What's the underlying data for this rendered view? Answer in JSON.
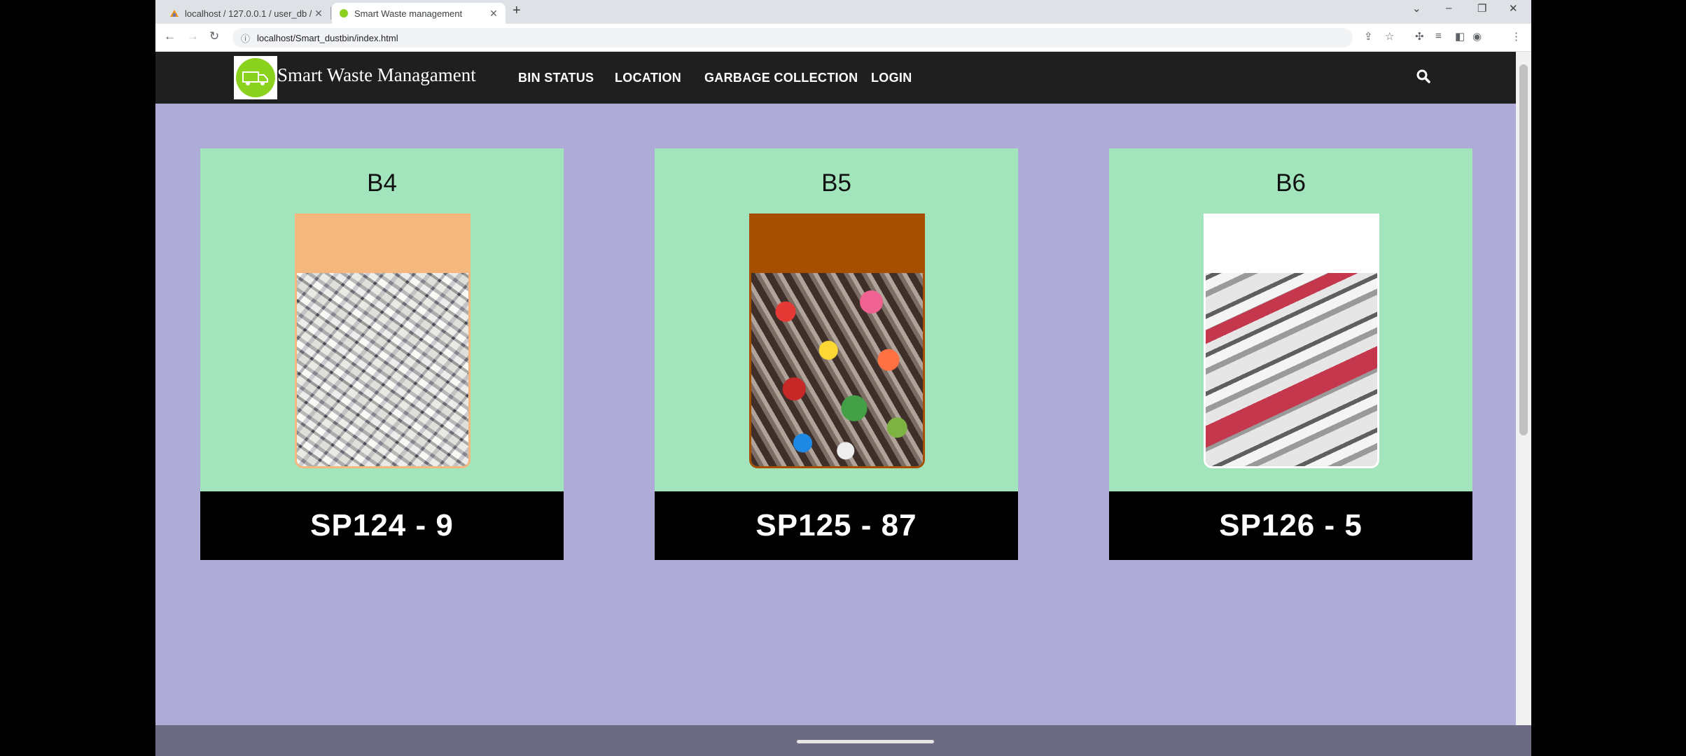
{
  "browser": {
    "tabs": [
      {
        "title": "localhost / 127.0.0.1 / user_db / ..."
      },
      {
        "title": "Smart Waste management"
      }
    ],
    "address": "localhost/Smart_dustbin/index.html"
  },
  "navbar": {
    "brand": "Smart Waste Managament",
    "links": [
      "BIN STATUS",
      "LOCATION",
      "GARBAGE COLLECTION",
      "LOGIN"
    ]
  },
  "bins": [
    {
      "id": "B4",
      "code": "SP124 - 9",
      "fill_fraction": 0.77,
      "accent_color": "#f6b77f",
      "contents": "newspapers"
    },
    {
      "id": "B5",
      "code": "SP125 - 87",
      "fill_fraction": 0.77,
      "accent_color": "#a64f00",
      "contents": "bottles-and-cans"
    },
    {
      "id": "B6",
      "code": "SP126 - 5",
      "fill_fraction": 0.77,
      "accent_color": "#ffffff",
      "contents": "medicine-vials"
    }
  ],
  "colors": {
    "page_background": "#aeacd6",
    "card_background": "#a2e5bc",
    "navbar_background": "#1f1f1f",
    "logo_green": "#8bd21f"
  }
}
